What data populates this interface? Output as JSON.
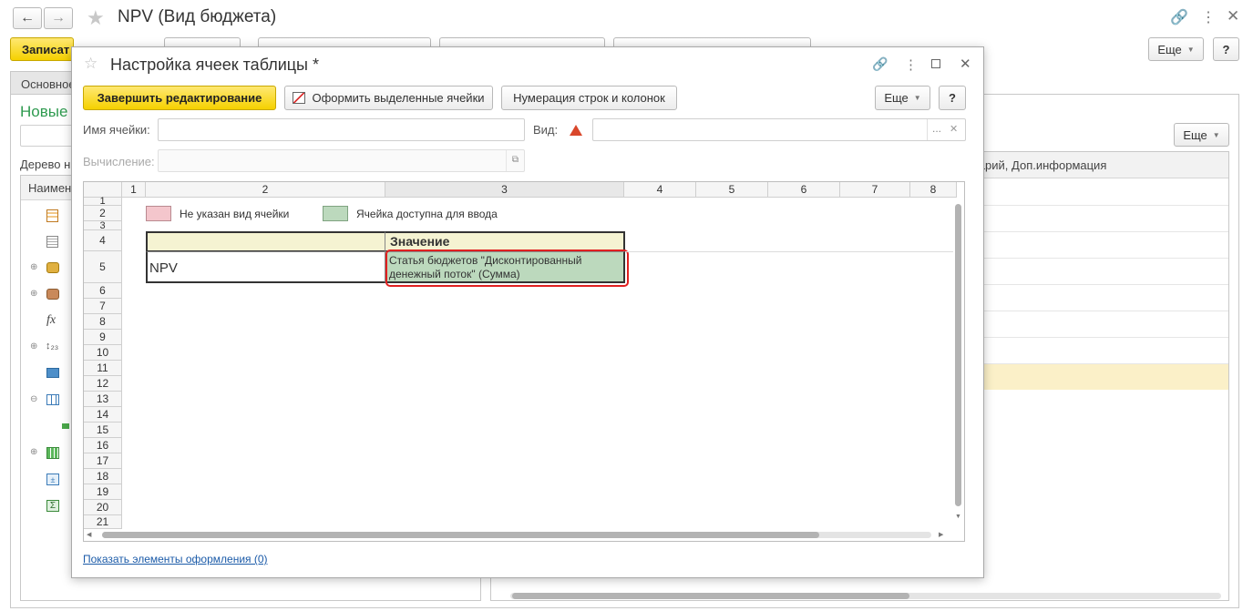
{
  "main_window": {
    "title": "NPV (Вид бюджета)",
    "save_button": "Записат",
    "more_button": "Еще",
    "help_button": "?",
    "tab_main": "Основное",
    "new_label": "Новые",
    "tree_label": "Дерево н",
    "name_column": "Наимен",
    "right_more": "Еще",
    "right_column_header": "тарий, Доп.информация"
  },
  "dialog": {
    "title": "Настройка ячеек таблицы *",
    "finish_button": "Завершить редактирование",
    "format_button": "Оформить выделенные ячейки",
    "numbering_button": "Нумерация строк и колонок",
    "more_button": "Еще",
    "help_button": "?",
    "cell_name_label": "Имя ячейки:",
    "cell_name_value": "",
    "view_label": "Вид:",
    "view_value": "",
    "calc_label": "Вычисление:",
    "calc_value": "",
    "footer_link": "Показать элементы оформления (0)"
  },
  "grid": {
    "columns": [
      "1",
      "2",
      "3",
      "4",
      "5",
      "6",
      "7",
      "8"
    ],
    "rows": [
      "1",
      "2",
      "3",
      "4",
      "5",
      "6",
      "7",
      "8",
      "9",
      "10",
      "11",
      "12",
      "13",
      "14",
      "15",
      "16",
      "17",
      "18",
      "19",
      "20",
      "21"
    ],
    "legend_not_set": "Не указан вид ячейки",
    "legend_input": "Ячейка доступна для ввода",
    "header_value": "Значение",
    "row5_name": "NPV",
    "row5_value": "Статья бюджетов \"Дисконтированный денежный поток\" (Сумма)"
  },
  "colors": {
    "accent_yellow": "#f5d100",
    "legend_pink": "#f4c6cc",
    "legend_green": "#bcd9bd",
    "highlight_red": "#e02020",
    "header_cream": "#f5f3d2",
    "link_blue": "#1a5aa8",
    "green_title": "#2e9a4f"
  }
}
